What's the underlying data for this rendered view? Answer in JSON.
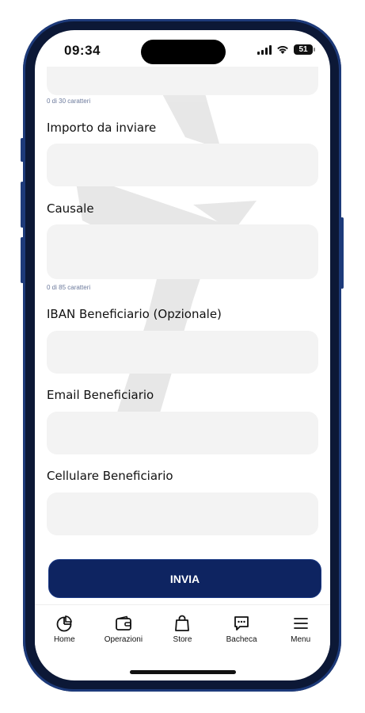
{
  "status_bar": {
    "time": "09:34",
    "battery": "51"
  },
  "form": {
    "name_counter": "0 di 30 caratteri",
    "amount_label": "Importo da inviare",
    "reason_label": "Causale",
    "reason_counter": "0 di 85 caratteri",
    "iban_label": "IBAN Beneficiario (Opzionale)",
    "email_label": "Email Beneficiario",
    "phone_label": "Cellulare Beneficiario",
    "submit_label": "INVIA"
  },
  "tabbar": {
    "items": [
      {
        "label": "Home",
        "icon": "pie-chart-icon"
      },
      {
        "label": "Operazioni",
        "icon": "wallet-icon"
      },
      {
        "label": "Store",
        "icon": "shopping-bag-icon"
      },
      {
        "label": "Bacheca",
        "icon": "chat-bubble-icon"
      },
      {
        "label": "Menu",
        "icon": "menu-icon"
      }
    ]
  },
  "colors": {
    "accent": "#0e2461",
    "field_bg": "#f3f3f3",
    "counter": "#6c7a9c"
  }
}
